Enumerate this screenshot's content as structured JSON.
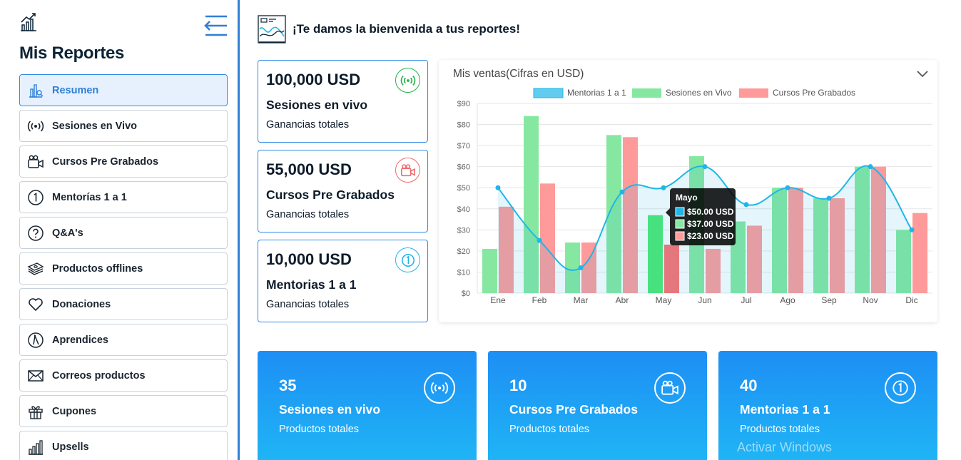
{
  "header": {
    "welcome": "¡Te damos la bienvenida a tus reportes!"
  },
  "sidebar": {
    "title": "Mis Reportes",
    "items": [
      {
        "label": "Resumen",
        "icon": "chart-icon",
        "active": true
      },
      {
        "label": "Sesiones en Vivo",
        "icon": "broadcast-icon"
      },
      {
        "label": "Cursos Pre Grabados",
        "icon": "video-camera-icon"
      },
      {
        "label": "Mentorías 1 a 1",
        "icon": "number-one-icon"
      },
      {
        "label": "Q&A's",
        "icon": "question-icon"
      },
      {
        "label": "Productos offlines",
        "icon": "money-icon"
      },
      {
        "label": "Donaciones",
        "icon": "heart-icon"
      },
      {
        "label": "Aprendices",
        "icon": "compass-icon"
      },
      {
        "label": "Correos productos",
        "icon": "envelope-icon"
      },
      {
        "label": "Cupones",
        "icon": "gift-icon"
      },
      {
        "label": "Upsells",
        "icon": "bar-chart-icon"
      }
    ]
  },
  "stats": [
    {
      "amount": "100,000 USD",
      "name": "Sesiones en vivo",
      "sub": "Ganancias totales",
      "icon": "broadcast-icon",
      "color": "#22b14c"
    },
    {
      "amount": "55,000 USD",
      "name": "Cursos Pre Grabados",
      "sub": "Ganancias totales",
      "icon": "video-camera-icon",
      "color": "#ee6b6b"
    },
    {
      "amount": "10,000 USD",
      "name": "Mentorias 1 a 1",
      "sub": "Ganancias totales",
      "icon": "number-one-icon",
      "color": "#1fb6e8"
    }
  ],
  "totals": [
    {
      "count": "35",
      "name": "Sesiones en vivo",
      "sub": "Productos totales",
      "icon": "broadcast-icon"
    },
    {
      "count": "10",
      "name": "Cursos Pre Grabados",
      "sub": "Productos totales",
      "icon": "video-camera-icon"
    },
    {
      "count": "40",
      "name": "Mentorias 1 a 1",
      "sub": "Productos totales",
      "icon": "number-one-icon"
    }
  ],
  "watermark": "Activar Windows",
  "chart_data": {
    "type": "bar",
    "title": "Mis ventas(Cifras en USD)",
    "categories": [
      "Ene",
      "Feb",
      "Mar",
      "Abr",
      "May",
      "Jun",
      "Jul",
      "Ago",
      "Sep",
      "Nov",
      "Dic"
    ],
    "ylim": [
      0,
      90
    ],
    "y_ticks": [
      "$0",
      "$10",
      "$20",
      "$30",
      "$40",
      "$50",
      "$60",
      "$70",
      "$80",
      "$90"
    ],
    "grid": true,
    "legend_position": "top",
    "series": [
      {
        "name": "Mentorias 1 a 1",
        "kind": "line",
        "color": "#1fb6e8",
        "values": [
          50,
          25,
          12,
          48,
          50,
          60,
          42,
          50,
          45,
          60,
          30
        ]
      },
      {
        "name": "Sesiones en Vivo",
        "kind": "bar",
        "color": "#86e8a0",
        "values": [
          21,
          84,
          24,
          75,
          37,
          65,
          34,
          50,
          45,
          60,
          30
        ]
      },
      {
        "name": "Cursos Pre Grabados",
        "kind": "bar",
        "color": "#ff9a9a",
        "values": [
          41,
          52,
          24,
          74,
          23,
          21,
          32,
          50,
          45,
          60,
          38
        ]
      }
    ],
    "tooltip": {
      "title": "Mayo",
      "category_index": 4,
      "lines": [
        "$50.00 USD",
        "$37.00 USD",
        "$23.00 USD"
      ]
    }
  }
}
